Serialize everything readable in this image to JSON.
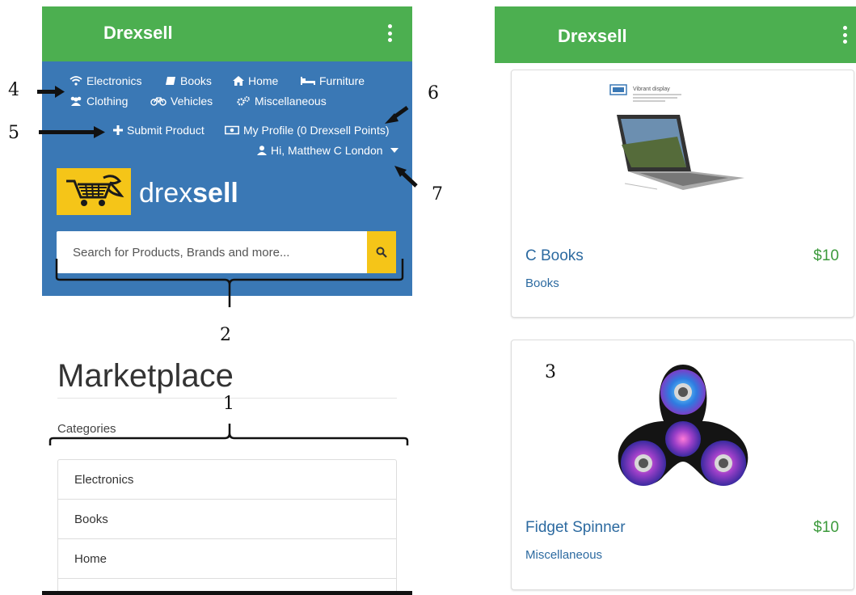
{
  "left_app": {
    "title": "Drexsell",
    "nav": {
      "electronics": "Electronics",
      "books": "Books",
      "home": "Home",
      "furniture": "Furniture",
      "clothing": "Clothing",
      "vehicles": "Vehicles",
      "miscellaneous": "Miscellaneous",
      "submit_product": "Submit Product",
      "my_profile": "My Profile (0 Drexsell Points)",
      "user_greeting": "Hi, Matthew C London"
    },
    "logo": {
      "prefix": "drex",
      "suffix": "sell"
    },
    "search": {
      "placeholder": "Search for Products, Brands and more..."
    },
    "page_title": "Marketplace",
    "categories_heading": "Categories",
    "categories": [
      "Electronics",
      "Books",
      "Home",
      ""
    ]
  },
  "right_app": {
    "title": "Drexsell",
    "products": [
      {
        "name": "C Books",
        "price": "$10",
        "category": "Books",
        "image_caption": "Vibrant display"
      },
      {
        "name": "Fidget Spinner",
        "price": "$10",
        "category": "Miscellaneous"
      }
    ]
  },
  "annotations": [
    "1",
    "2",
    "3",
    "4",
    "5",
    "6",
    "7"
  ],
  "colors": {
    "appbar_green": "#4caf50",
    "nav_blue": "#3a78b5",
    "accent_yellow": "#f5c518",
    "link_blue": "#2c6aa0",
    "price_green": "#3c9a3c"
  }
}
